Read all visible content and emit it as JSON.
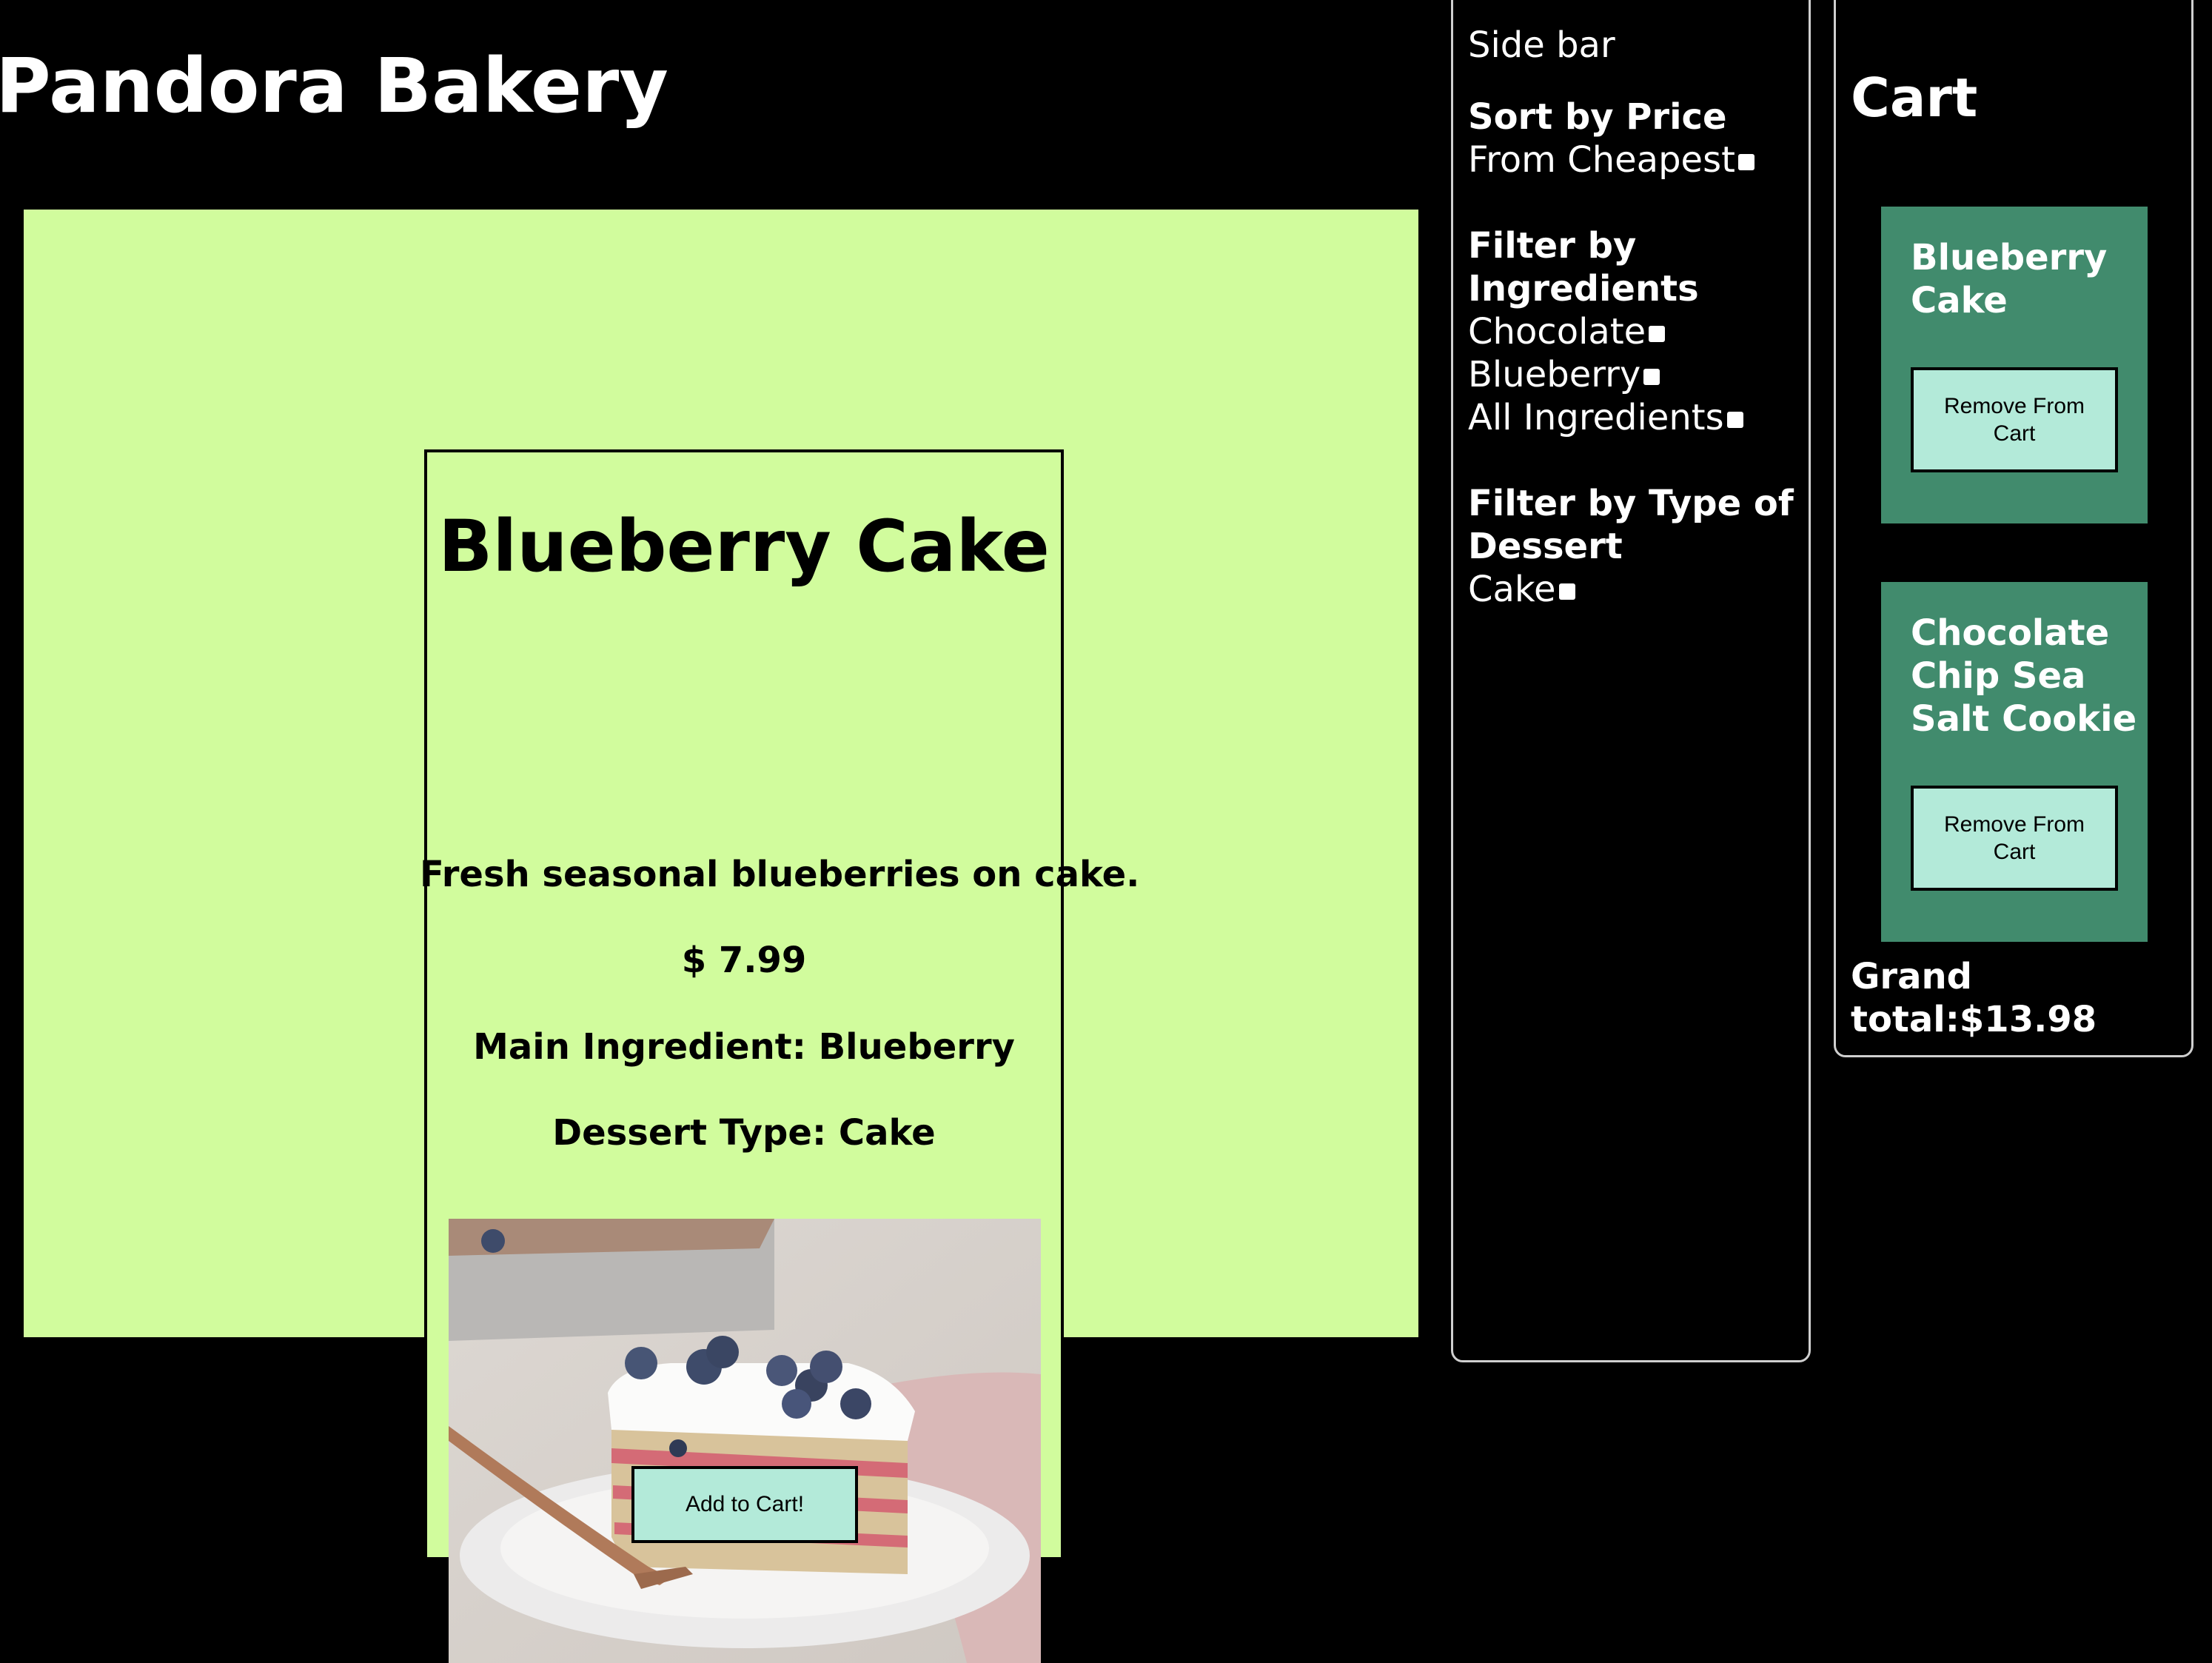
{
  "header": {
    "title": "Pandora Bakery"
  },
  "product": {
    "name": "Blueberry Cake",
    "description": "Fresh seasonal blueberries on cake.",
    "price": "$ 7.99",
    "main_ingredient": "Main Ingredient: Blueberry",
    "dessert_type": "Dessert Type: Cake",
    "image_icon": "blueberry-cake-photo",
    "add_button_label": "Add to Cart!"
  },
  "sidebar": {
    "label": "Side bar",
    "sort_heading": "Sort by Price",
    "sort_option": "From Cheapest",
    "ingredients_heading_line1": "Filter by",
    "ingredients_heading_line2": "Ingredients",
    "ingredient_options": [
      "Chocolate",
      "Blueberry",
      "All Ingredients"
    ],
    "type_heading_line1": "Filter by Type of",
    "type_heading_line2": "Dessert",
    "type_options": [
      "Cake"
    ]
  },
  "cart": {
    "title": "Cart",
    "items": [
      {
        "name": "Blueberry Cake",
        "remove_label": "Remove From Cart"
      },
      {
        "name": "Chocolate Chip Sea Salt Cookie",
        "remove_label": "Remove From Cart"
      }
    ],
    "grand_total": "Grand total:$13.98"
  },
  "colors": {
    "background": "#000000",
    "main_area": "#d1fc9d",
    "button": "#b3ead9",
    "cart_item": "#418b6d",
    "sidebar_border": "#cfcfcf"
  }
}
